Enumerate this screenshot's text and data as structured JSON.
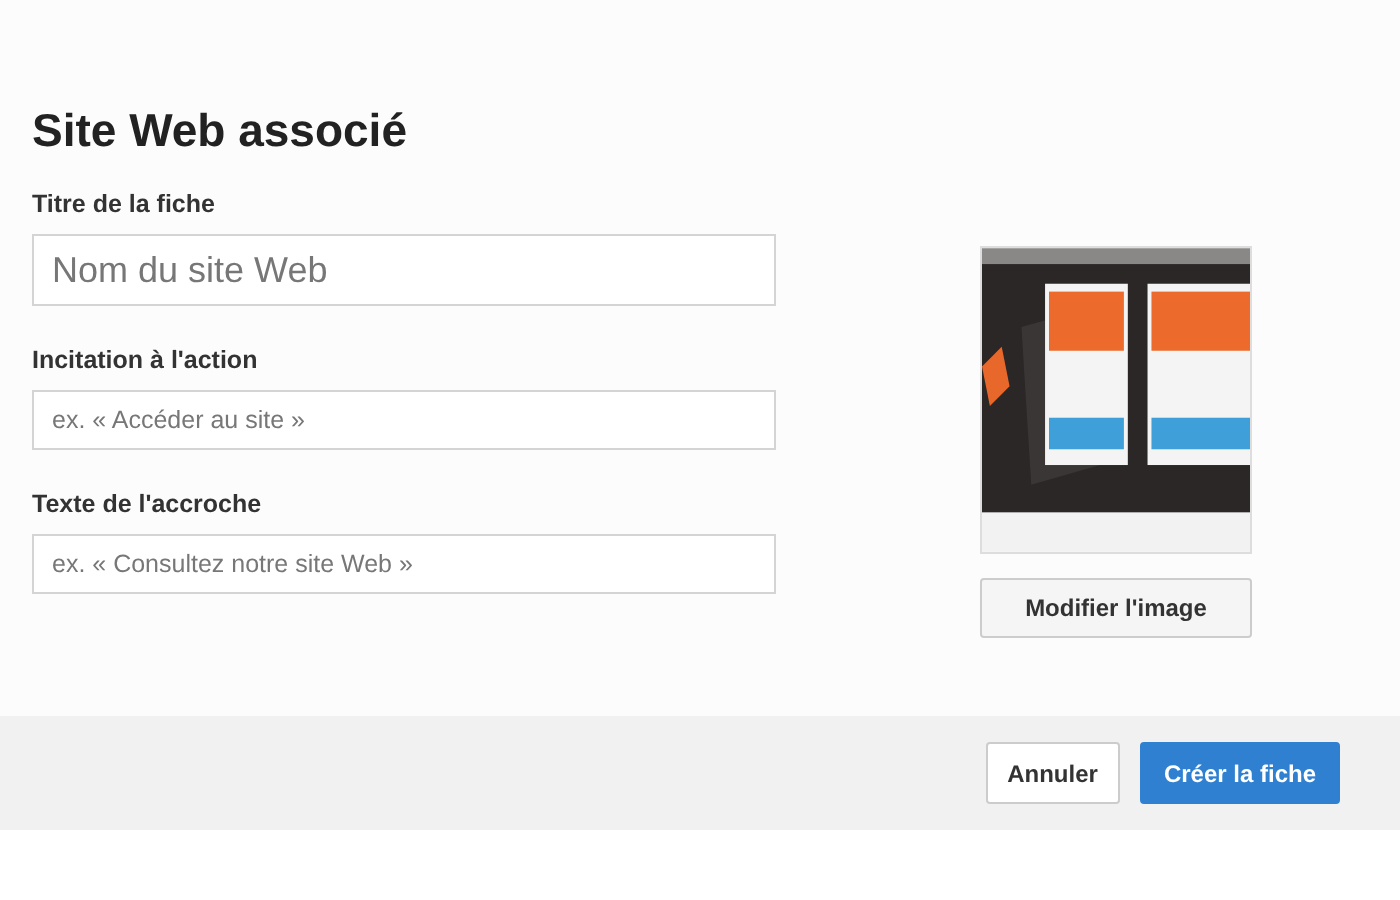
{
  "title": "Site Web associé",
  "fields": [
    {
      "label": "Titre de la fiche",
      "placeholder": "Nom du site Web",
      "kind": "large"
    },
    {
      "label": "Incitation à l'action",
      "placeholder": "ex. « Accéder au site »",
      "kind": "normal"
    },
    {
      "label": "Texte de l'accroche",
      "placeholder": "ex. « Consultez notre site Web »",
      "kind": "normal"
    }
  ],
  "image": {
    "kind": "picture",
    "button": "Modifier l'image"
  },
  "footer": {
    "buttons": [
      {
        "label": "Annuler",
        "kind": "secondary"
      },
      {
        "label": "Créer la fiche",
        "kind": "primary"
      }
    ]
  }
}
